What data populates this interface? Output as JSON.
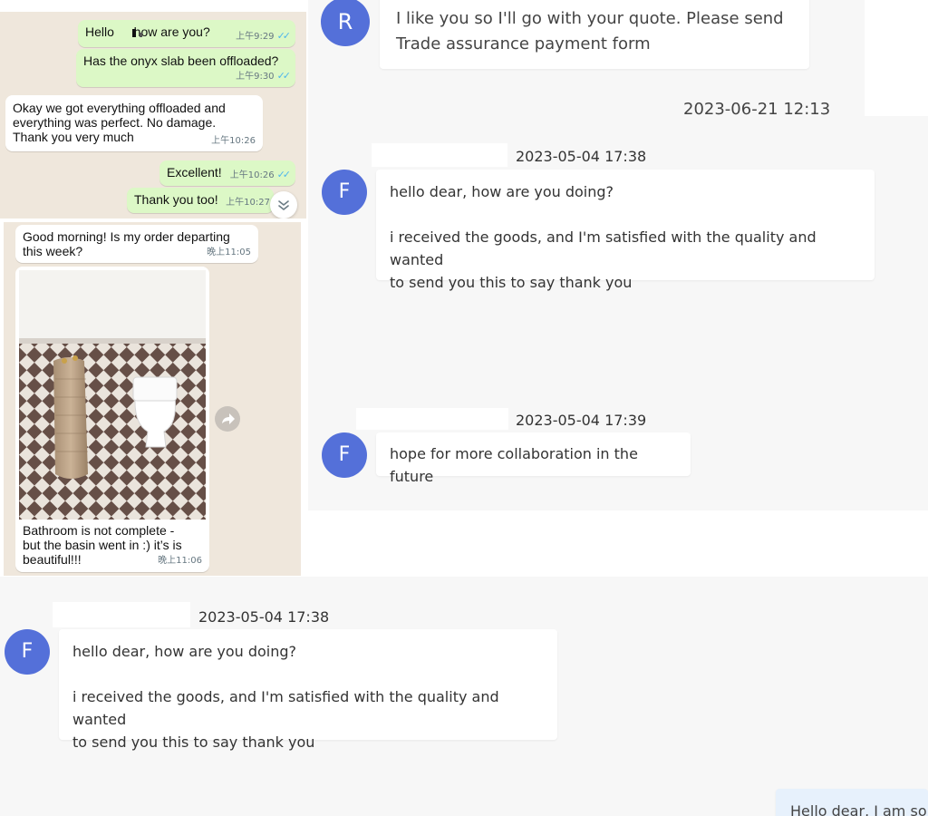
{
  "whatsapp_top": {
    "messages": [
      {
        "dir": "out",
        "text": "Hello    how are you?",
        "time": "上午9:29"
      },
      {
        "dir": "out",
        "text": "Has the onyx slab been offloaded?",
        "time": "上午9:30"
      },
      {
        "dir": "in",
        "text": "Okay we got everything offloaded and\neverything was perfect. No damage.\nThank you very much",
        "time": "上午10:26"
      },
      {
        "dir": "out",
        "text": "Excellent!",
        "time": "上午10:26"
      },
      {
        "dir": "out",
        "text": "Thank you too!",
        "time": "上午10:27"
      }
    ],
    "ticks": "✓✓"
  },
  "whatsapp_bottom": {
    "message_1": {
      "text": "Good morning! Is my order departing\nthis week?",
      "time": "晚上11:05"
    },
    "photo_message": {
      "caption": "Bathroom is not complete -\nbut the basin went in :) it’s is\nbeautiful!!!",
      "time": "晚上11:06"
    }
  },
  "desktop_chat_top": {
    "message_r": {
      "avatar": "R",
      "lines": [
        "I like you so I'll go with your quote. Please send",
        "Trade assurance payment form"
      ]
    },
    "timestamp_partial": "2023-06-21 12:13"
  },
  "desktop_chat_mid": {
    "group1": {
      "timestamp": "2023-05-04 17:38",
      "avatar": "F",
      "para1": "hello dear, how are you doing?",
      "para2_lines": [
        "i received the goods, and I'm satisfied with the quality and wanted",
        "to send you this to say thank you"
      ]
    },
    "group2": {
      "timestamp": "2023-05-04 17:39",
      "avatar": "F",
      "text": "hope for more collaboration in the future"
    }
  },
  "desktop_chat_bottom": {
    "group1": {
      "timestamp": "2023-05-04 17:38",
      "avatar": "F",
      "para1": "hello dear, how are you doing?",
      "para2_lines": [
        "i received the goods, and I'm satisfied with the quality and wanted",
        "to send you this to say thank you"
      ]
    },
    "outgoing_partial": "Hello dear, I am so h"
  },
  "colors": {
    "avatar": "#5470d9",
    "wa_out": "#dcf8c6",
    "wa_in": "#ffffff",
    "wa_bg": "#efe7dc",
    "dc_bg": "#f7f7f7",
    "read_ticks": "#4fb6ec"
  },
  "icons": {
    "scroll_down": "double-chevron-down-icon",
    "forward": "forward-arrow-icon"
  }
}
